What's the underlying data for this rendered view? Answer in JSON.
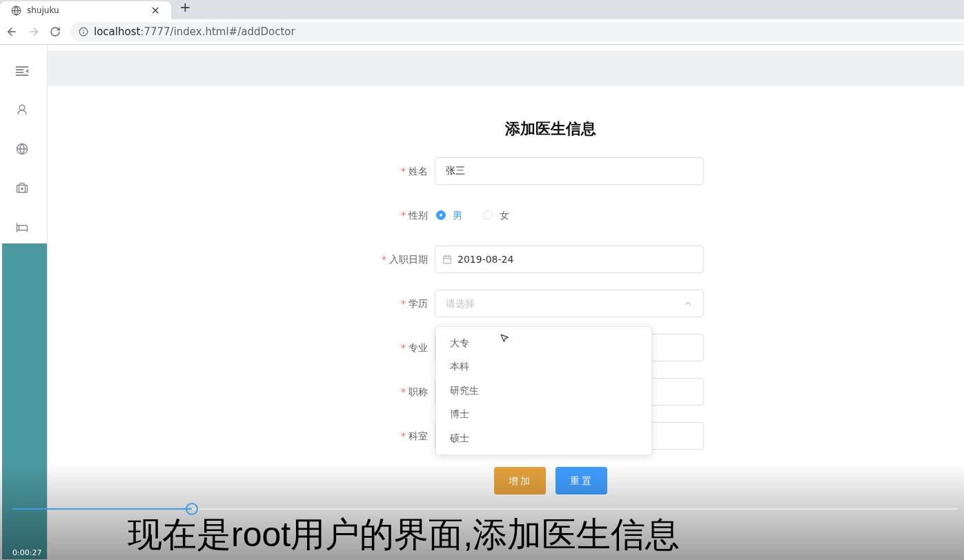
{
  "browser": {
    "tab_title": "shujuku",
    "close_glyph": "×",
    "new_tab_glyph": "+",
    "url_host": "localhost",
    "url_rest": ":7777/index.html#/addDoctor"
  },
  "sidebar": {
    "items": [
      {
        "kind": "fold"
      },
      {
        "kind": "user"
      },
      {
        "kind": "globe"
      },
      {
        "kind": "medicine"
      },
      {
        "kind": "bed"
      }
    ]
  },
  "form": {
    "title": "添加医生信息",
    "fields": [
      {
        "label": "姓名",
        "required_mark": "*",
        "kind": "text",
        "value": "张三"
      },
      {
        "label": "性别",
        "required_mark": "*",
        "kind": "radio",
        "options": [
          {
            "label": "男",
            "selected": true
          },
          {
            "label": "女",
            "selected": false
          }
        ]
      },
      {
        "label": "入职日期",
        "required_mark": "*",
        "kind": "date",
        "value": "2019-08-24"
      },
      {
        "label": "学历",
        "required_mark": "*",
        "kind": "select",
        "placeholder": "请选择",
        "expanded": true,
        "options": [
          "大专",
          "本科",
          "研究生",
          "博士",
          "硕士"
        ]
      },
      {
        "label": "专业",
        "required_mark": "*",
        "kind": "text"
      },
      {
        "label": "职称",
        "required_mark": "*",
        "kind": "text"
      },
      {
        "label": "科室",
        "required_mark": "*",
        "kind": "text"
      }
    ],
    "buttons": [
      {
        "label": "增加",
        "color": "#e6a23c"
      },
      {
        "label": "重置",
        "color": "#409eff"
      }
    ]
  },
  "video": {
    "subtitle": "现在是root用户的界面,添加医生信息",
    "time": "0:00:27",
    "level": 0.19
  }
}
